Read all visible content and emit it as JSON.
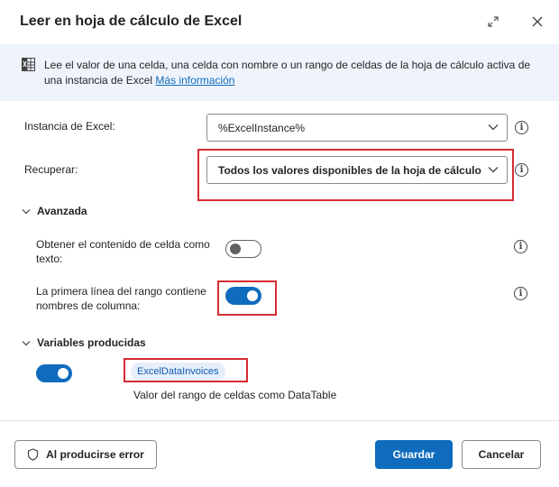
{
  "dialog": {
    "title": "Leer en hoja de cálculo de Excel"
  },
  "info": {
    "text": "Lee el valor de una celda, una celda con nombre o un rango de celdas de la hoja de cálculo activa de una instancia de Excel",
    "link": "Más información"
  },
  "fields": {
    "instance_label": "Instancia de Excel:",
    "instance_value": "%ExcelInstance%",
    "retrieve_label": "Recuperar:",
    "retrieve_value": "Todos los valores disponibles de la hoja de cálculo"
  },
  "advanced": {
    "heading": "Avanzada",
    "option1_label": "Obtener el contenido de celda como texto:",
    "option1_on": false,
    "option2_label": "La primera línea del rango contiene nombres de columna:",
    "option2_on": true
  },
  "variables": {
    "heading": "Variables producidas",
    "enabled": true,
    "name": "ExcelDataInvoices",
    "description": "Valor del rango de celdas como DataTable"
  },
  "footer": {
    "error_button": "Al producirse error",
    "save_button": "Guardar",
    "cancel_button": "Cancelar"
  },
  "colors": {
    "accent": "#0f6cbd",
    "highlight": "#d72b33",
    "banner": "#eff4fc"
  }
}
